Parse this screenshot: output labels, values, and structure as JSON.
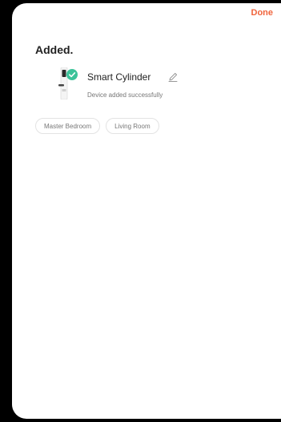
{
  "header": {
    "done_label": "Done"
  },
  "title": "Added.",
  "device": {
    "name": "Smart Cylinder",
    "status": "Device added successfully",
    "image_icon": "smart-lock-icon",
    "check_icon": "check-circle-icon",
    "edit_icon": "pencil-icon"
  },
  "rooms": [
    {
      "label": "Master Bedroom"
    },
    {
      "label": "Living Room"
    }
  ],
  "colors": {
    "accent": "#f0643c",
    "success": "#3cc39a",
    "background": "#ffffff",
    "frame": "#000000"
  }
}
